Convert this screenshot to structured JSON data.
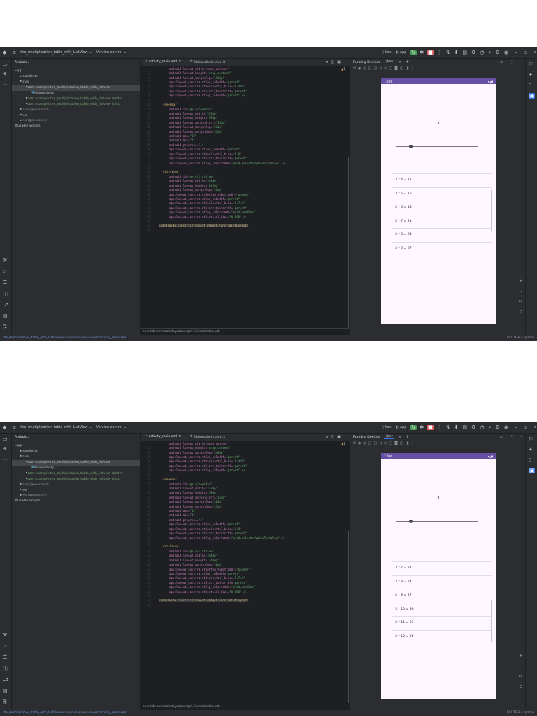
{
  "ide": {
    "project_name": "the_multiplication_table_with_ListView",
    "vcs": "Version control",
    "device_selector": "kev",
    "run_config": "app",
    "project_view": "Android",
    "tree": [
      {
        "label": "app",
        "kind": "folder"
      },
      {
        "label": "manifests",
        "kind": "folder"
      },
      {
        "label": "java",
        "kind": "folder"
      },
      {
        "label": "com.example.the_multiplication_table_with_listview",
        "kind": "package-selected"
      },
      {
        "label": "MainActivity",
        "kind": "class"
      },
      {
        "label": "com.example.the_multiplication_table_with_listview (andro",
        "kind": "package-green"
      },
      {
        "label": "com.example.the_multiplication_table_with_listview (test)",
        "kind": "package-green"
      },
      {
        "label": "java (generated)",
        "kind": "generated"
      },
      {
        "label": "res",
        "kind": "folder"
      },
      {
        "label": "res (generated)",
        "kind": "generated"
      },
      {
        "label": "Gradle Scripts",
        "kind": "gradle"
      }
    ],
    "tabs": [
      {
        "label": "activity_main.xml",
        "active": true
      },
      {
        "label": "MainActivity.java",
        "active": false
      }
    ],
    "warning_count": "1",
    "code_lines": [
      {
        "n": "",
        "a": "android:layout_width=\"wrap_content\"",
        "kind": "attr",
        "indent": 6
      },
      {
        "n": "13",
        "a": "android:layout_height=",
        "v": "\"wrap_content\"",
        "kind": "attr",
        "indent": 6
      },
      {
        "n": "14",
        "a": "android:layout_marginTop=",
        "v": "\"148dp\"",
        "kind": "attr",
        "indent": 6
      },
      {
        "n": "15",
        "a": "app:layout_constraintEnd_toEndOf=",
        "v": "\"parent\"",
        "kind": "attr",
        "indent": 6
      },
      {
        "n": "16",
        "a": "app:layout_constraintHorizontal_bias=",
        "v": "\"0.498\"",
        "kind": "attr",
        "indent": 6
      },
      {
        "n": "17",
        "a": "app:layout_constraintStart_toStartOf=",
        "v": "\"parent\"",
        "kind": "attr",
        "indent": 6
      },
      {
        "n": "18",
        "a": "app:layout_constraintTop_toTopOf=",
        "v": "\"parent\" />",
        "kind": "attr",
        "indent": 6
      },
      {
        "n": "19",
        "a": "",
        "kind": "blank",
        "indent": 0
      },
      {
        "n": "20",
        "a": "<SeekBar",
        "kind": "tag",
        "indent": 3
      },
      {
        "n": "21",
        "a": "android:id=",
        "v": "\"@+id/seekBar\"",
        "kind": "attr",
        "indent": 6
      },
      {
        "n": "22",
        "a": "android:layout_width=",
        "v": "\"333dp\"",
        "kind": "attr",
        "indent": 6
      },
      {
        "n": "23",
        "a": "android:layout_height=",
        "v": "\"79dp\"",
        "kind": "attr",
        "indent": 6
      },
      {
        "n": "24",
        "a": "android:layout_marginStart=",
        "v": "\"35dp\"",
        "kind": "attr",
        "indent": 6
      },
      {
        "n": "25",
        "a": "android:layout_marginTop=",
        "v": "\"32dp\"",
        "kind": "attr",
        "indent": 6
      },
      {
        "n": "26",
        "a": "android:layout_marginEnd=",
        "v": "\"35dp\"",
        "kind": "attr",
        "indent": 6
      },
      {
        "n": "27",
        "a": "android:max=",
        "v": "\"12\"",
        "kind": "attr",
        "indent": 6
      },
      {
        "n": "28",
        "a": "android:min=",
        "v": "\"1\"",
        "kind": "attr",
        "indent": 6
      },
      {
        "n": "29",
        "a": "android:progress=",
        "v": "\"1\"",
        "kind": "attr",
        "indent": 6
      },
      {
        "n": "30",
        "a": "app:layout_constraintEnd_toEndOf=",
        "v": "\"parent\"",
        "kind": "attr",
        "indent": 6
      },
      {
        "n": "31",
        "a": "app:layout_constraintHorizontal_bias=",
        "v": "\"0.0\"",
        "kind": "attr",
        "indent": 6
      },
      {
        "n": "32",
        "a": "app:layout_constraintStart_toStartOf=",
        "v": "\"parent\"",
        "kind": "attr",
        "indent": 6
      },
      {
        "n": "33",
        "a": "app:layout_constraintTop_toBottomOf=",
        "v": "\"@+id/selectedValueTextView\" />",
        "kind": "attr",
        "indent": 6
      },
      {
        "n": "34",
        "a": "",
        "kind": "blank",
        "indent": 0
      },
      {
        "n": "35",
        "a": "<ListView",
        "kind": "tag",
        "indent": 3
      },
      {
        "n": "36",
        "a": "android:id=",
        "v": "\"@+id/listView\"",
        "kind": "attr",
        "indent": 6
      },
      {
        "n": "37",
        "a": "android:layout_width=",
        "v": "\"344dp\"",
        "kind": "attr",
        "indent": 6
      },
      {
        "n": "38",
        "a": "android:layout_height=",
        "v": "\"249dp\"",
        "kind": "attr",
        "indent": 6
      },
      {
        "n": "39",
        "a": "android:layout_marginTop=",
        "v": "\"16dp\"",
        "kind": "attr",
        "indent": 6
      },
      {
        "n": "40",
        "a": "app:layout_constraintBottom_toBottomOf=",
        "v": "\"parent\"",
        "kind": "attr",
        "indent": 6
      },
      {
        "n": "41",
        "a": "app:layout_constraintEnd_toEndOf=",
        "v": "\"parent\"",
        "kind": "attr",
        "indent": 6
      },
      {
        "n": "42",
        "a": "app:layout_constraintHorizontal_bias=",
        "v": "\"0.744\"",
        "kind": "attr",
        "indent": 6
      },
      {
        "n": "43",
        "a": "app:layout_constraintStart_toStartOf=",
        "v": "\"parent\"",
        "kind": "attr",
        "indent": 6
      },
      {
        "n": "44",
        "a": "app:layout_constraintTop_toBottomOf=",
        "v": "\"@+id/seekBar\"",
        "kind": "attr",
        "indent": 6
      },
      {
        "n": "45",
        "a": "app:layout_constraintVertical_bias=",
        "v": "\"0.098\" />",
        "kind": "attr",
        "indent": 6
      },
      {
        "n": "46",
        "a": "",
        "kind": "blank",
        "indent": 0
      },
      {
        "n": "47",
        "a": "</androidx.constraintlayout.widget.ConstraintLayout>",
        "kind": "endtag",
        "indent": 1
      },
      {
        "n": "48",
        "a": "",
        "kind": "blank",
        "indent": 0
      }
    ],
    "editor_breadcrumb": "androidx.constraintlayout.widget.ConstraintLayout",
    "running_devices_title": "Running Devices",
    "device_tab": "kev",
    "statusbar_path": [
      "the_multiplication_table_with_ListView",
      "app",
      "src",
      "main",
      "res",
      "layout",
      "activity_main.xml"
    ],
    "statusbar_right": "LF   UTF-8   4 spaces"
  },
  "screenshots": [
    {
      "clock": "7:08",
      "selected_value": "3",
      "seek_progress": 0.18,
      "list_rows": [
        "3 * 4 = 12",
        "3 * 5 = 15",
        "3 * 6 = 18",
        "3 * 7 = 21",
        "3 * 8 = 24",
        "3 * 9 = 27"
      ]
    },
    {
      "clock": "7:09",
      "selected_value": "3",
      "seek_progress": 0.18,
      "list_rows": [
        "3 * 7 = 21",
        "3 * 8 = 24",
        "3 * 9 = 27",
        "3 * 10 = 30",
        "3 * 11 = 33",
        "3 * 12 = 36"
      ]
    }
  ],
  "colors": {
    "ide_bg": "#1e1f22",
    "panel_bg": "#2b2d30",
    "accent": "#3574f0",
    "device_status_bar": "#6750a4",
    "app_bg": "#fef7ff"
  }
}
